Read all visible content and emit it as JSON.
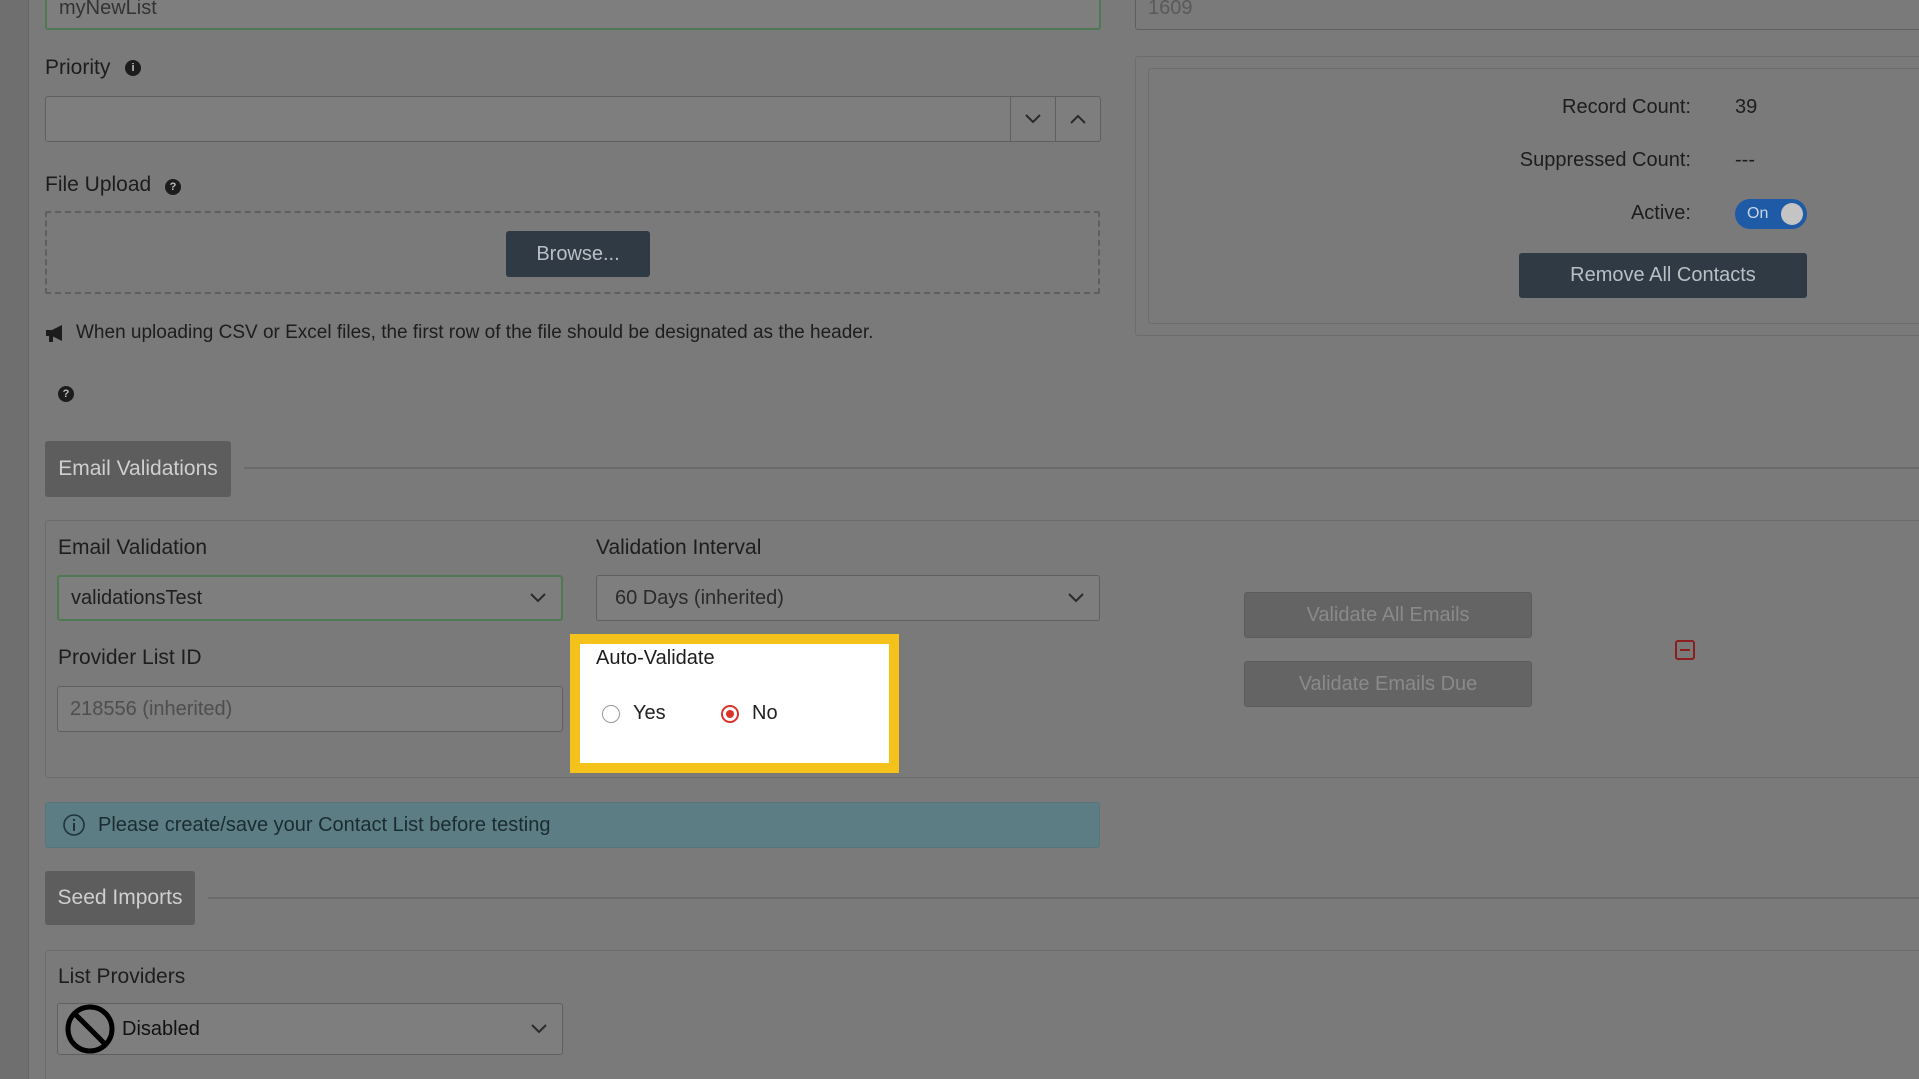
{
  "list_name": {
    "value": "myNewList"
  },
  "list_id": {
    "value": "1609"
  },
  "priority": {
    "label": "Priority",
    "value": ""
  },
  "file_upload": {
    "label": "File Upload",
    "browse_label": "Browse...",
    "notice": "When uploading CSV or Excel files, the first row of the file should be designated as the header."
  },
  "stats": {
    "record_count_label": "Record Count:",
    "record_count_value": "39",
    "suppressed_count_label": "Suppressed Count:",
    "suppressed_count_value": "---",
    "active_label": "Active:",
    "active_toggle": "On",
    "remove_all_label": "Remove All Contacts"
  },
  "email_validations": {
    "section_title": "Email Validations",
    "email_validation_label": "Email Validation",
    "email_validation_value": "validationsTest",
    "validation_interval_label": "Validation Interval",
    "validation_interval_value": "60 Days (inherited)",
    "provider_list_id_label": "Provider List ID",
    "provider_list_id_value": "218556 (inherited)",
    "auto_validate_label": "Auto-Validate",
    "auto_validate_yes": "Yes",
    "auto_validate_no": "No",
    "auto_validate_selected": "No",
    "validate_all_label": "Validate All Emails",
    "validate_due_label": "Validate Emails Due"
  },
  "alert": {
    "text": "Please create/save your Contact List before testing"
  },
  "seed_imports": {
    "section_title": "Seed Imports",
    "list_providers_label": "List Providers",
    "list_providers_value": "Disabled"
  },
  "colors": {
    "highlight": "#f5c21b",
    "toggle_on": "#1f5aa6",
    "radio_selected": "#d9342b"
  }
}
